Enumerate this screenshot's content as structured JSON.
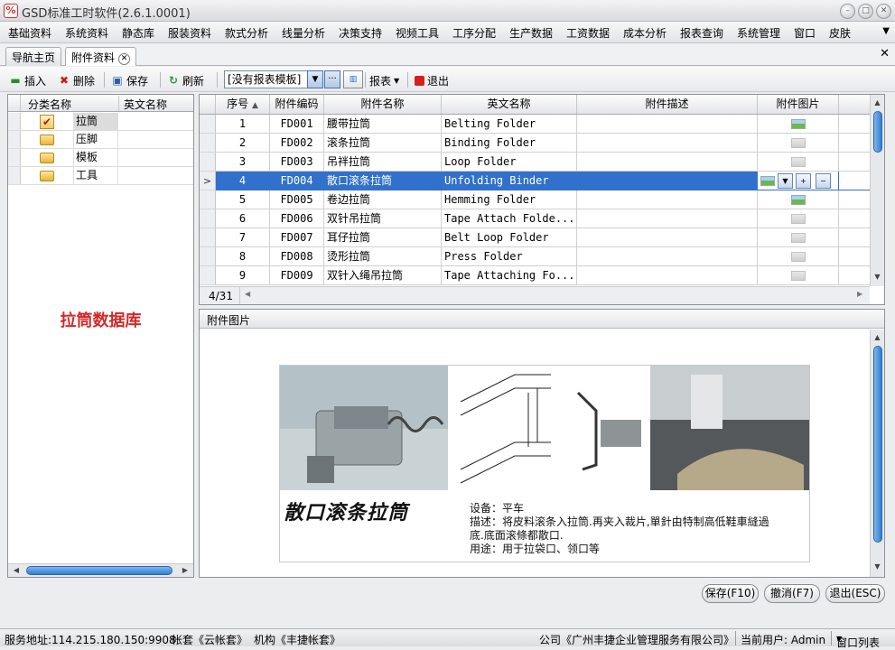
{
  "window": {
    "title": "GSD标准工时软件(2.6.1.0001)",
    "app_icon": "%"
  },
  "menu": [
    "基础资料",
    "系统资料",
    "静态库",
    "服装资料",
    "款式分析",
    "线量分析",
    "决策支持",
    "视频工具",
    "工序分配",
    "生产数据",
    "工资数据",
    "成本分析",
    "报表查询",
    "系统管理",
    "窗口",
    "皮肤"
  ],
  "tabs": [
    {
      "label": "导航主页"
    },
    {
      "label": "附件资料"
    }
  ],
  "toolbar": {
    "insert": "插入",
    "delete": "删除",
    "save": "保存",
    "refresh": "刷新",
    "report_template": "[没有报表模板]",
    "more": "···",
    "report": "报表",
    "exit": "退出"
  },
  "category_panel": {
    "columns": [
      "分类名称",
      "英文名称"
    ],
    "items": [
      "拉筒",
      "压脚",
      "模板",
      "工具"
    ],
    "title": "拉筒数据库"
  },
  "grid": {
    "columns": [
      "序号",
      "附件编码",
      "附件名称",
      "英文名称",
      "附件描述",
      "附件图片"
    ],
    "rows": [
      {
        "no": "1",
        "code": "FD001",
        "name": "腰带拉筒",
        "en": "Belting Folder",
        "desc": "",
        "has_image": true
      },
      {
        "no": "2",
        "code": "FD002",
        "name": "滚条拉筒",
        "en": "Binding Folder",
        "desc": "",
        "has_image": false
      },
      {
        "no": "3",
        "code": "FD003",
        "name": "吊袢拉筒",
        "en": "Loop Folder",
        "desc": "",
        "has_image": false
      },
      {
        "no": "4",
        "code": "FD004",
        "name": "散口滚条拉筒",
        "en": "Unfolding Binder",
        "desc": "",
        "has_image": true
      },
      {
        "no": "5",
        "code": "FD005",
        "name": "卷边拉筒",
        "en": "Hemming Folder",
        "desc": "",
        "has_image": true
      },
      {
        "no": "6",
        "code": "FD006",
        "name": "双针吊拉筒",
        "en": "Tape Attach Folde...",
        "desc": "",
        "has_image": false
      },
      {
        "no": "7",
        "code": "FD007",
        "name": "耳仔拉筒",
        "en": "Belt Loop Folder",
        "desc": "",
        "has_image": false
      },
      {
        "no": "8",
        "code": "FD008",
        "name": "烫形拉筒",
        "en": "Press Folder",
        "desc": "",
        "has_image": false
      },
      {
        "no": "9",
        "code": "FD009",
        "name": "双针入绳吊拉筒",
        "en": "Tape Attaching Fo...",
        "desc": "",
        "has_image": false
      }
    ],
    "selected_index": 3,
    "record_counter": "4/31",
    "current_row_marker": ">",
    "sort_indicator": "▲"
  },
  "attachment": {
    "header": "附件图片",
    "caption": "散口滚条拉筒",
    "desc_lines": [
      "设备：平车",
      "描述：将皮料滚条入拉筒.再夹入裁片,單針由特制高低鞋車縫過",
      "底.底面滚條都散口.",
      "用途：用于拉袋口、领口等"
    ]
  },
  "buttons": {
    "save": "保存(F10)",
    "cancel": "撤消(F7)",
    "exit": "退出(ESC)"
  },
  "status": {
    "server": "服务地址:114.215.180.150:9908",
    "account": "帐套《云帐套》",
    "org": "机构《丰捷帐套》",
    "company": "公司《广州丰捷企业管理服务有限公司》",
    "user": "当前用户: Admin",
    "window_list": "窗口列表"
  },
  "colors": {
    "selection": "#3171cc",
    "title_red": "#d42828",
    "scroll_blue": "#2f7fd3"
  }
}
